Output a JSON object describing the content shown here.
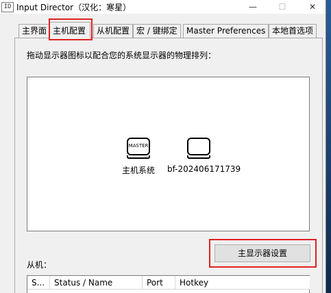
{
  "window": {
    "icon_text": "ID",
    "title": "Input Director（汉化：寒星）",
    "minimize_glyph": "—",
    "maximize_glyph": "☐",
    "close_glyph": "✕"
  },
  "tabs": [
    "主界面",
    "主机配置",
    "从机配置",
    "宏 / 键绑定",
    "Master Preferences",
    "本地首选项"
  ],
  "active_tab": "主机配置",
  "instruction": "拖动显示器图标以配合您的系统显示器的物理排列：",
  "monitors": [
    {
      "screen_text": "MASTER",
      "label": "主机系统"
    },
    {
      "screen_text": "",
      "label": "bf-202406171739"
    }
  ],
  "primary_button": "主显示器设置",
  "slaves_label": "从机：",
  "table_headers": [
    "S...",
    "Status / Name",
    "Port",
    "Hotkey"
  ],
  "colors": {
    "highlight": "#e02020",
    "window_bg": "#f0f0f0"
  }
}
